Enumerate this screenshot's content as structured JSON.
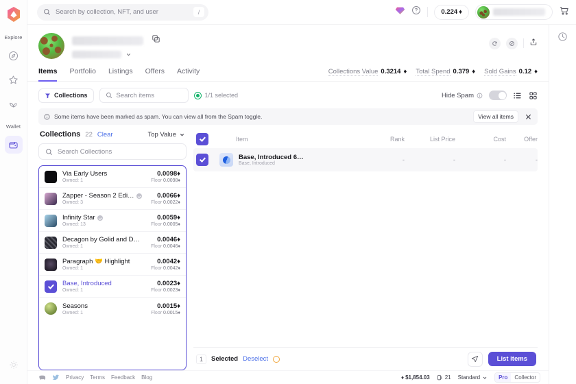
{
  "app": {
    "accent": "#5b4fd6",
    "search_placeholder": "Search by collection, NFT, and user",
    "search_shortcut": "/",
    "balance": "0.224",
    "eth": "♦"
  },
  "rail": {
    "explore_label": "Explore",
    "wallet_label": "Wallet",
    "icons": [
      "compass-icon",
      "star-icon",
      "sprout-icon",
      "wallet-icon"
    ]
  },
  "profile": {
    "copy_icon": "copy-icon",
    "actions": [
      "refresh-icon",
      "sync-icon",
      "share-icon"
    ]
  },
  "tabs": [
    {
      "label": "Items",
      "active": true
    },
    {
      "label": "Portfolio",
      "active": false
    },
    {
      "label": "Listings",
      "active": false
    },
    {
      "label": "Offers",
      "active": false
    },
    {
      "label": "Activity",
      "active": false
    }
  ],
  "stats": [
    {
      "label": "Collections Value",
      "value": "0.3214"
    },
    {
      "label": "Total Spend",
      "value": "0.379"
    },
    {
      "label": "Sold Gains",
      "value": "0.12"
    }
  ],
  "filterbar": {
    "collections_chip": "Collections",
    "search_items_placeholder": "Search items",
    "selected_text": "1/1 selected",
    "hide_spam_label": "Hide Spam",
    "hide_spam_on": false,
    "list_view_icon": "list-view-icon",
    "grid_view_icon": "grid-view-icon"
  },
  "notice": {
    "text": "Some items have been marked as spam. You can view all from the Spam toggle.",
    "button": "View all items",
    "close_icon": "close-icon"
  },
  "collections": {
    "title": "Collections",
    "count": "22",
    "clear": "Clear",
    "sort": "Top Value",
    "search_placeholder": "Search Collections",
    "items": [
      {
        "name": "Via Early Users",
        "owned": "Owned: 1",
        "value": "0.0098",
        "floor": "0.0098",
        "verified": false,
        "selected": false,
        "thumb": "#0b0b0e"
      },
      {
        "name": "Zapper - Season 2 Edi…",
        "owned": "Owned: 3",
        "value": "0.0066",
        "floor": "0.0022",
        "verified": true,
        "selected": false,
        "thumb": "#8a4f78"
      },
      {
        "name": "Infinity Star",
        "owned": "Owned: 13",
        "value": "0.0059",
        "floor": "0.0005",
        "verified": true,
        "selected": false,
        "thumb": "#7aa6c8"
      },
      {
        "name": "Decagon by Golid and D…",
        "owned": "Owned: 1",
        "value": "0.0046",
        "floor": "0.0046",
        "verified": false,
        "selected": false,
        "thumb": "#2b2b33"
      },
      {
        "name": "Paragraph 🤝 Highlight",
        "owned": "Owned: 1",
        "value": "0.0042",
        "floor": "0.0042",
        "verified": false,
        "selected": false,
        "thumb": "#1d1a22"
      },
      {
        "name": "Base, Introduced",
        "owned": "Owned: 1",
        "value": "0.0023",
        "floor": "0.0023",
        "verified": false,
        "selected": true,
        "thumb": "#5b4fd6"
      },
      {
        "name": "Seasons",
        "owned": "Owned: 1",
        "value": "0.0015",
        "floor": "0.0015",
        "verified": false,
        "selected": false,
        "thumb": "#6f8f3a"
      }
    ],
    "floor_label": "Floor"
  },
  "table": {
    "columns": [
      "Item",
      "Rank",
      "List Price",
      "Cost",
      "Offer"
    ],
    "rows": [
      {
        "name": "Base, Introduced 6…",
        "collection": "Base, Introduced",
        "rank": "-",
        "list_price": "-",
        "cost": "-",
        "offer": "-",
        "checked": true
      }
    ],
    "header_checked": true
  },
  "selection_footer": {
    "count": "1",
    "selected_label": "Selected",
    "deselect": "Deselect",
    "send_icon": "send-icon",
    "list_button": "List items"
  },
  "page_footer": {
    "social": [
      "discord-icon",
      "twitter-icon"
    ],
    "links": [
      "Privacy",
      "Terms",
      "Feedback",
      "Blog"
    ],
    "eth_price": "$1,854.03",
    "gas": "21",
    "speed": "Standard",
    "mode_pro": "Pro",
    "mode_collector": "Collector"
  }
}
